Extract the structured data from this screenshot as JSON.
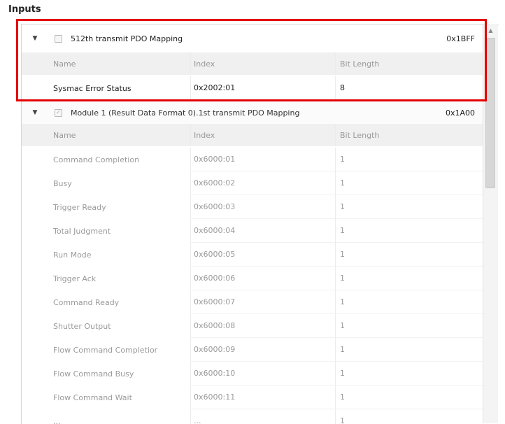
{
  "section_title": "Inputs",
  "columns": {
    "name": "Name",
    "index": "Index",
    "bit_length": "Bit Length"
  },
  "groups": [
    {
      "expander": "▼",
      "checked": false,
      "title": "512th transmit PDO Mapping",
      "code": "0x1BFF",
      "rows": [
        {
          "name": "Sysmac Error Status",
          "index": "0x2002:01",
          "bits": "8"
        }
      ]
    },
    {
      "expander": "▼",
      "checked": true,
      "checkmark": "✓",
      "title": "Module 1 (Result Data Format 0).1st transmit PDO Mapping",
      "code": "0x1A00",
      "rows": [
        {
          "name": "Command Completion",
          "index": "0x6000:01",
          "bits": "1"
        },
        {
          "name": "Busy",
          "index": "0x6000:02",
          "bits": "1"
        },
        {
          "name": "Trigger Ready",
          "index": "0x6000:03",
          "bits": "1"
        },
        {
          "name": "Total Judgment",
          "index": "0x6000:04",
          "bits": "1"
        },
        {
          "name": "Run Mode",
          "index": "0x6000:05",
          "bits": "1"
        },
        {
          "name": "Trigger Ack",
          "index": "0x6000:06",
          "bits": "1"
        },
        {
          "name": "Command Ready",
          "index": "0x6000:07",
          "bits": "1"
        },
        {
          "name": "Shutter Output",
          "index": "0x6000:08",
          "bits": "1"
        },
        {
          "name": "Flow Command Completior",
          "index": "0x6000:09",
          "bits": "1"
        },
        {
          "name": "Flow Command Busy",
          "index": "0x6000:10",
          "bits": "1"
        },
        {
          "name": "Flow Command Wait",
          "index": "0x6000:11",
          "bits": "1"
        },
        {
          "name": "...",
          "index": "...",
          "bits": "1"
        }
      ]
    }
  ],
  "scrollbar": {
    "up_arrow": "▲"
  },
  "colors": {
    "highlight": "#e40000",
    "header_bg": "#f0f0f0",
    "disabled_text": "#9a9a9a"
  }
}
